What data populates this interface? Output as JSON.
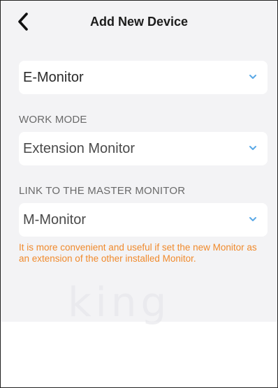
{
  "header": {
    "title": "Add New Device",
    "back_icon": "back-chevron-icon"
  },
  "device_type": {
    "value": "E-Monitor",
    "icon": "chevron-down-icon"
  },
  "work_mode": {
    "label": "WORK MODE",
    "value": "Extension Monitor",
    "icon": "chevron-down-icon"
  },
  "link_master": {
    "label": "LINK TO THE MASTER MONITOR",
    "value": "M-Monitor",
    "icon": "chevron-down-icon"
  },
  "hint": {
    "text": "It is more convenient and useful if set the new Monitor as an extension of the other installed Monitor."
  },
  "colors": {
    "background": "#f3f3f5",
    "card": "#ffffff",
    "chevron": "#5aa8e6",
    "hint": "#f08a2c",
    "title": "#1c1c1c"
  },
  "watermark": {
    "text": "king"
  }
}
